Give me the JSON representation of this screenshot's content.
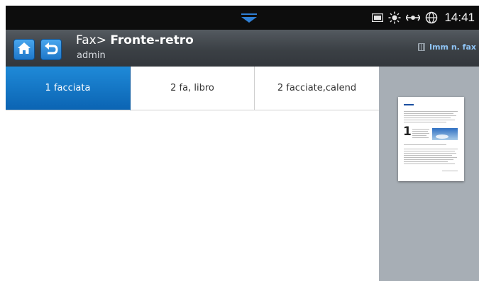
{
  "status_bar": {
    "time": "14:41",
    "icons": [
      "notification-pull-icon",
      "toner-icon",
      "eco-sun-icon",
      "network-icon",
      "globe-icon"
    ]
  },
  "header": {
    "title_prefix": "Fax>",
    "title_strong": "Fronte-retro",
    "user": "admin",
    "right_label": "Imm n. fax"
  },
  "tabs": [
    {
      "label": "1 facciata",
      "selected": true
    },
    {
      "label": "2 fa, libro",
      "selected": false
    },
    {
      "label": "2 facciate,calend",
      "selected": false
    }
  ],
  "preview": {
    "icon": "document-preview",
    "page_number": "1"
  },
  "colors": {
    "accent_blue": "#1570c4",
    "header_bg": "#3f4449",
    "status_bg": "#0d0d0d",
    "preview_bg": "#a7aeb5"
  }
}
